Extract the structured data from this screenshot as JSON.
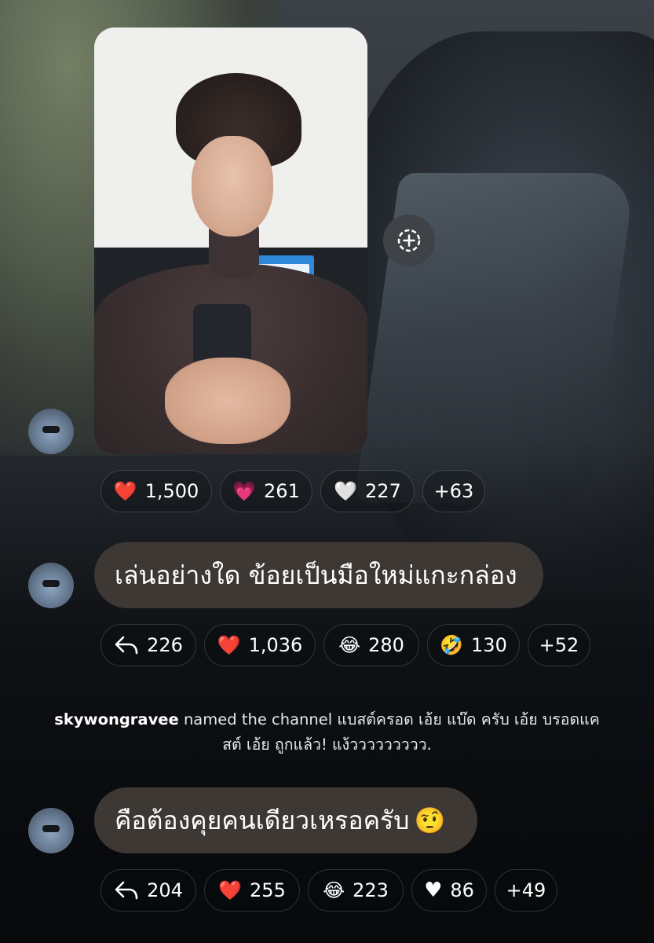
{
  "reactions_photo": [
    {
      "emoji": "❤️",
      "icon": "red-heart-icon",
      "count": "1,500"
    },
    {
      "emoji": "💗",
      "icon": "pink-heart-icon",
      "count": "261"
    },
    {
      "emoji": "🤍",
      "icon": "white-heart-icon",
      "count": "227"
    },
    {
      "more": "+63"
    }
  ],
  "message1": {
    "text": "เล่นอย่างใด ข้อยเป็นมือใหม่แกะกล่อง",
    "reply_count": "226",
    "reactions": [
      {
        "emoji": "❤️",
        "icon": "red-heart-icon",
        "count": "1,036"
      },
      {
        "emoji": "😂",
        "icon": "tears-of-joy-icon",
        "count": "280"
      },
      {
        "emoji": "🤣",
        "icon": "rofl-icon",
        "count": "130"
      }
    ],
    "more": "+52"
  },
  "system_message": {
    "username": "skywongravee",
    "text": " named the channel แบสต์ครอด เอ้ย แบ๊ด ครับ เอ้ย บรอดแคสต์ เอ้ย ถูกแล้ว! แง้ววววววววว."
  },
  "message2": {
    "text": "คือต้องคุยคนเดียวเหรอครับ",
    "trailing_emoji": "🤨",
    "reply_count": "204",
    "reactions": [
      {
        "emoji": "❤️",
        "icon": "red-heart-icon",
        "count": "255"
      },
      {
        "emoji": "😂",
        "icon": "tears-of-joy-icon",
        "count": "223"
      },
      {
        "emoji": "♥",
        "icon": "heart-suit-icon",
        "count": "86"
      }
    ],
    "more": "+49"
  },
  "colors": {
    "bubble": "#3d3834",
    "chip_border": "rgba(255,255,255,0.16)",
    "add_button": "#3f4246"
  }
}
